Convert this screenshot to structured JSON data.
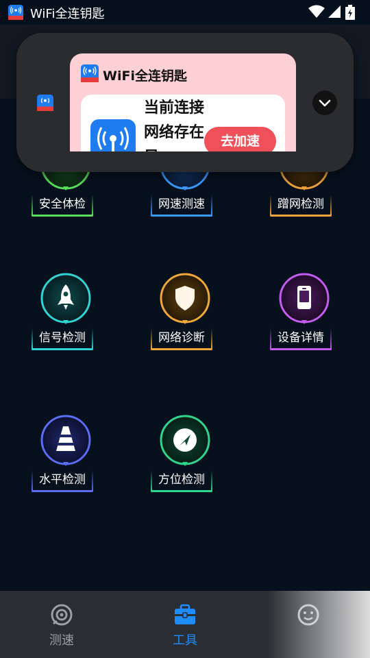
{
  "status_bar": {
    "app_name": "WiFi全连钥匙"
  },
  "notification": {
    "app_name": "WiFi全连钥匙",
    "message": "当前连接网络存在风",
    "action_label": "去加速"
  },
  "tools": [
    {
      "id": "safety",
      "label": "安全体检",
      "color": "#58e05c"
    },
    {
      "id": "speed",
      "label": "网速测速",
      "color": "#3a9bff"
    },
    {
      "id": "freeload",
      "label": "蹭网检测",
      "color": "#f0a43a"
    },
    {
      "id": "signal",
      "label": "信号检测",
      "color": "#2fd5d5"
    },
    {
      "id": "diagnose",
      "label": "网络诊断",
      "color": "#f0a838"
    },
    {
      "id": "device",
      "label": "设备详情",
      "color": "#c45cf0"
    },
    {
      "id": "level",
      "label": "水平检测",
      "color": "#5b6cf5"
    },
    {
      "id": "direction",
      "label": "方位检测",
      "color": "#2fd58e"
    }
  ],
  "bottom_nav": [
    {
      "id": "speed",
      "label": "测速",
      "icon": "speedometer-icon",
      "active": false
    },
    {
      "id": "tools",
      "label": "工具",
      "icon": "toolbox-icon",
      "active": true
    },
    {
      "id": "mine",
      "label": "",
      "icon": "smiley-icon",
      "active": false
    }
  ],
  "colors": {
    "active": "#1e8dff",
    "inactive": "#9aa0a6"
  }
}
